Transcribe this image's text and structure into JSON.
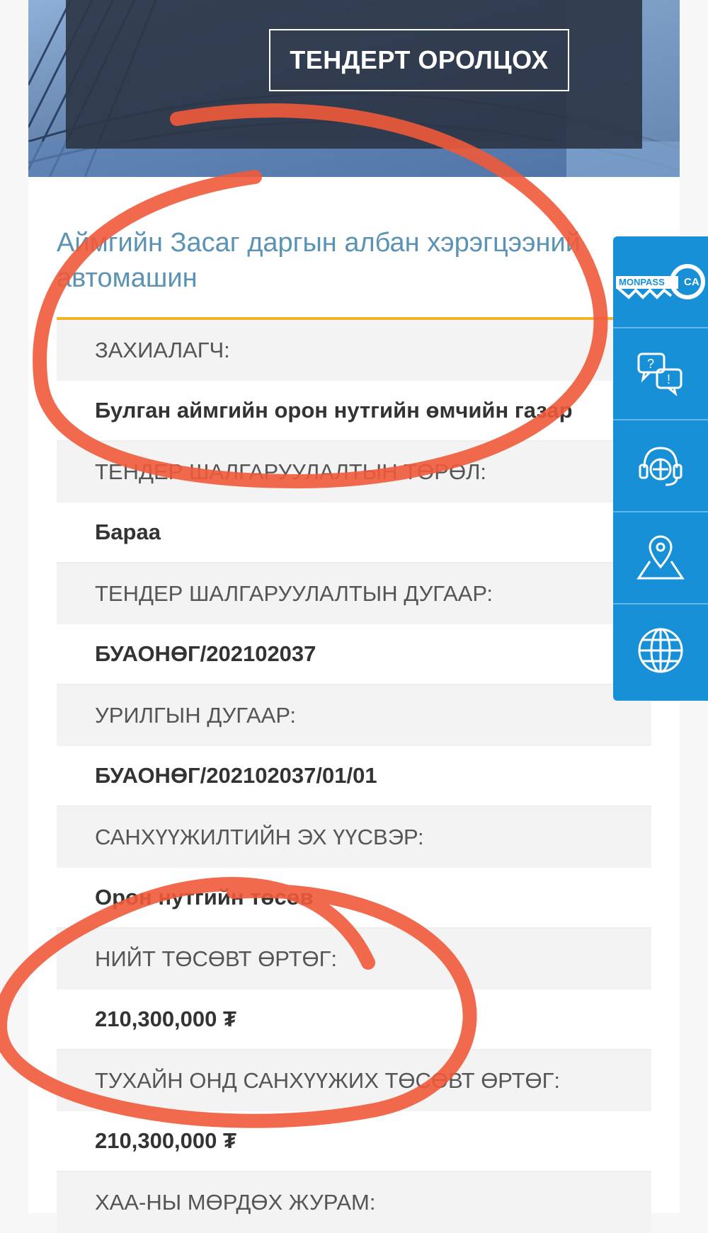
{
  "hero": {
    "button_label": "ТЕНДЕРТ ОРОЛЦОХ"
  },
  "tender": {
    "title": "Аймгийн Засаг даргын албан хэрэгцээний автомашин",
    "fields": [
      {
        "label": "ЗАХИАЛАГЧ:",
        "value": "Булган аймгийн орон нутгийн өмчийн газар"
      },
      {
        "label": "ТЕНДЕР ШАЛГАРУУЛАЛТЫН ТӨРӨЛ:",
        "value": "Бараа"
      },
      {
        "label": "ТЕНДЕР ШАЛГАРУУЛАЛТЫН ДУГААР:",
        "value": "БУАОНӨГ/202102037"
      },
      {
        "label": "УРИЛГЫН ДУГААР:",
        "value": "БУАОНӨГ/202102037/01/01"
      },
      {
        "label": "САНХҮҮЖИЛТИЙН ЭХ ҮҮСВЭР:",
        "value": "Орон нутгийн төсөв"
      },
      {
        "label": "НИЙТ ТӨСӨВТ ӨРТӨГ:",
        "value": "210,300,000 ₮"
      },
      {
        "label": "ТУХАЙН ОНД САНХҮҮЖИХ ТӨСӨВТ ӨРТӨГ:",
        "value": "210,300,000 ₮"
      },
      {
        "label": "ХАА-НЫ МӨРДӨХ ЖУРАМ:",
        "value": ""
      }
    ]
  },
  "side_toolbar": {
    "items": [
      {
        "icon": "monpass-ca-logo",
        "text": "MONPASS",
        "badge": "CA"
      },
      {
        "icon": "chat-question-icon"
      },
      {
        "icon": "headset-support-icon"
      },
      {
        "icon": "map-pin-icon"
      },
      {
        "icon": "globe-icon"
      }
    ]
  },
  "colors": {
    "title": "#5a93b3",
    "divider": "#f0b429",
    "toolbar": "#1790d8",
    "annotation": "#f05a3a"
  }
}
